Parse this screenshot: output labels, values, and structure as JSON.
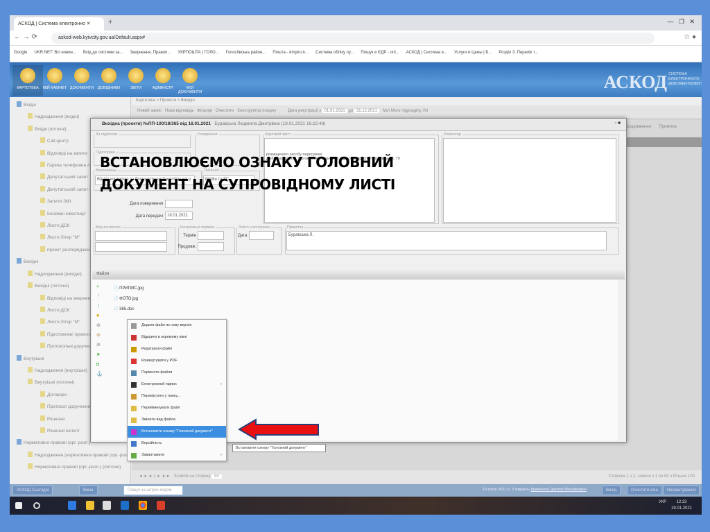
{
  "browser": {
    "tab_title": "АСКОД | Система електронно",
    "url": "askod-web.kyivcity.gov.ua/Default.aspx#",
    "bookmarks": [
      "Google",
      "UKR.NET: Всі новин...",
      "Вхід до системи за...",
      "Звернення. Правоп...",
      "УКРПОШТА | ГОЛО...",
      "Голосіївська район...",
      "Пошта - dmytro.k...",
      "Система обліку пу...",
      "Пошук в ЄДР - onl...",
      "АСКОД | Система е...",
      "Услуги и Цены | Б...",
      "Розділ 3. Перелік т..."
    ]
  },
  "app": {
    "logo": "АСКОД",
    "logo_sub": "СИСТЕМА ЕЛЕКТРОННОГО ДОКУМЕНТООБІГУ",
    "nav": [
      "КАРТОТЕКА",
      "МІЙ КАБІНЕТ",
      "ДОКУМЕНТИ",
      "ДОВІДНИКИ",
      "ЗВІТИ",
      "АДМІНІСТР.",
      "МОЇ ДОКУМЕНТИ"
    ]
  },
  "sidebar": {
    "items": [
      {
        "label": "Вхідні",
        "level": 1
      },
      {
        "label": "Надходження (вхідні)",
        "level": 2
      },
      {
        "label": "Вхідні (поточні)",
        "level": 2
      },
      {
        "label": "Call-центр",
        "level": 3
      },
      {
        "label": "Відповіді на запити",
        "level": 3
      },
      {
        "label": "Гаряча телефонна лінія",
        "level": 3
      },
      {
        "label": "Депутатський запит",
        "level": 3
      },
      {
        "label": "Депутатський запит (до о",
        "level": 3
      },
      {
        "label": "Запити ЗМІ",
        "level": 3
      },
      {
        "label": "Іноземні інвестиції",
        "level": 3
      },
      {
        "label": "Листи ДСК",
        "level": 3
      },
      {
        "label": "Листи Літер \"М\"",
        "level": 3
      },
      {
        "label": "проект розпорядження",
        "level": 3
      },
      {
        "label": "Вихідні",
        "level": 1
      },
      {
        "label": "Надходження (вихідні)",
        "level": 2
      },
      {
        "label": "Вихідні (поточні)",
        "level": 2
      },
      {
        "label": "Відповіді на звернення",
        "level": 3
      },
      {
        "label": "Листи ДСК",
        "level": 3
      },
      {
        "label": "Листи Літер \"М\"",
        "level": 3
      },
      {
        "label": "Підготовлені проекти вих",
        "level": 3
      },
      {
        "label": "Протокольні доручення",
        "level": 3
      },
      {
        "label": "Внутрішні",
        "level": 1
      },
      {
        "label": "Надходження (внутрішні)",
        "level": 2
      },
      {
        "label": "Внутрішні (поточні)",
        "level": 2
      },
      {
        "label": "Договори",
        "level": 3
      },
      {
        "label": "Протокол доручення",
        "level": 3
      },
      {
        "label": "Рішення",
        "level": 3
      },
      {
        "label": "Рішення колегії",
        "level": 3
      },
      {
        "label": "Нормативно-правові (орг.-розп.)",
        "level": 1
      },
      {
        "label": "Надходження (нормативно-правові (орг.-розп",
        "level": 2
      },
      {
        "label": "Нормативно-правові (орг.-розп.) (поточні)",
        "level": 2
      }
    ]
  },
  "main": {
    "breadcrumb": "Картотека > Проекти > Вихідні",
    "toolbar": {
      "new_record": "Новий запис",
      "new_reply": "Нова відповідь",
      "filter": "Фільтри",
      "clear": "Очистити",
      "search_builder": "Конструктор пошуку",
      "date_label": "Дата реєстрації з",
      "date_from": "01.01.2021",
      "date_to_label": "до",
      "date_to": "31.12.2021",
      "mine": "Мої",
      "my_control": "Мого підрозділу",
      "all": "Усі"
    },
    "grid_headers": [
      "Ім'я продовження",
      "Примітка"
    ],
    "pager": {
      "page": "1",
      "pages_label": "Записів на сторінці",
      "per_page": "50",
      "summary": "Сторінка 1 з 2, записи з 1 по 50 з більше 100"
    }
  },
  "modal": {
    "title": "Вихідна (проекти) №ПП-100/18/365 від 18.01.2021",
    "author": "Буравська Людмила Дмитрівна (18.01.2021 16:22:48)",
    "legend_signature": "За підписом",
    "legend_signed": "Узгодження",
    "legend_prepared": "Підготував",
    "legend_executor": "Виконавець",
    "legend_issue": "Питання",
    "legend_summary": "Короткий зміст",
    "legend_comment": "Коментар",
    "executor": "Відділ контролю за благоустроєм Голосіївської р",
    "issue": "МАФи та ТС",
    "summary_lines": [
      "розміщеного засобу пересувної",
      "дрібнороздрібної торговельної мережі за адресою: просп. Голосіївський, 70"
    ],
    "return_date_label": "Дата повернення",
    "transfer_date_label": "Дата передачі",
    "transfer_date": "18.01.2021",
    "legend_control": "Вид контролю",
    "legend_terms": "Контрольні терміни",
    "legend_removed": "Знято з контролю",
    "legend_note": "Примітка",
    "term_label": "Термін",
    "extend_label": "Продовж.",
    "date_label": "Дата",
    "note": "Буравська Л.",
    "files_header": "Файли",
    "files": [
      "ПРИПИС.jpg",
      "ФОТО.jpg",
      "365.doc"
    ],
    "context_menu": [
      "Додати файл як нову версію",
      "Відкрити в окремому вікні",
      "Редагувати файл",
      "Конвертувати у PDF",
      "Порівняти файли",
      "Електронний підпис",
      "Перемістити у папку...",
      "Перейменувати файл",
      "Змінити вид файла",
      "Встановити ознаку \"Головний документ\"",
      "Версійність",
      "Завантажити"
    ],
    "tooltip": "Встановити ознаку \"Головний документ\""
  },
  "overlay_text": [
    "ВСТАНОВЛЮЄМО ОЗНАКУ ГОЛОВНИЙ",
    "ДОКУМЕНТ НА СУПРОВІДНОМУ ЛИСТІ"
  ],
  "statusbar": {
    "app": "АСКОД Сьогодні",
    "windows": "Вікна",
    "search_placeholder": "Пошук за штрих-кодом",
    "info": "19 січня 2021 р. 3 тиждень",
    "user": "Кравченко Дмитро Михайлович",
    "exit": "Вихід",
    "clear_cache": "Очистити кеш",
    "settings": "Налаштування"
  },
  "taskbar": {
    "lang": "УКР",
    "time": "12:33",
    "date": "19.01.2021"
  },
  "colors": {
    "highlight": "#3b8ee0",
    "arrow": "#e81010",
    "slide_bg": "#5b8fd8"
  }
}
